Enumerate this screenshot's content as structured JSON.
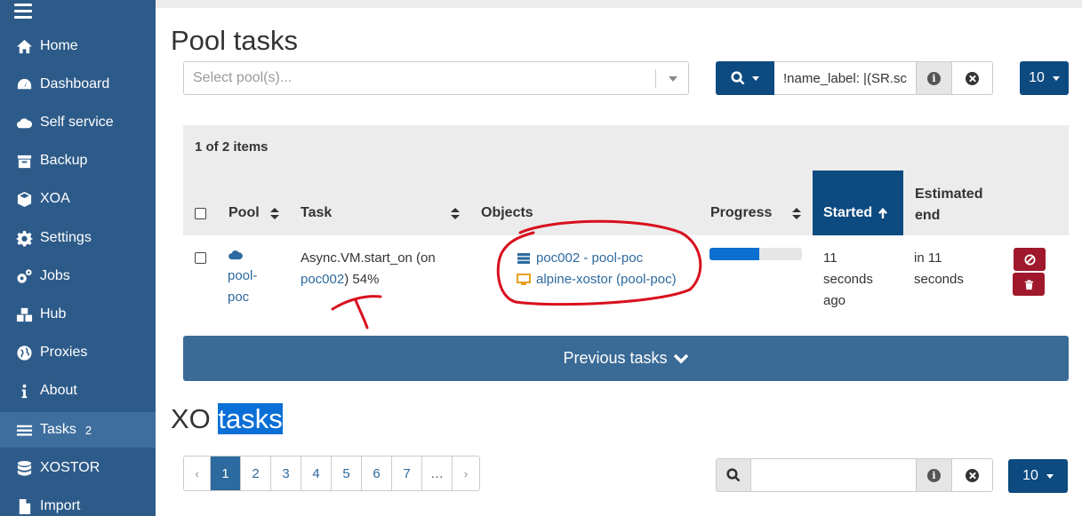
{
  "sidebar": {
    "items": [
      {
        "label": "Home",
        "icon": "home-icon"
      },
      {
        "label": "Dashboard",
        "icon": "dashboard-icon"
      },
      {
        "label": "Self service",
        "icon": "cloud-icon"
      },
      {
        "label": "Backup",
        "icon": "archive-icon"
      },
      {
        "label": "XOA",
        "icon": "cube-icon"
      },
      {
        "label": "Settings",
        "icon": "gear-icon"
      },
      {
        "label": "Jobs",
        "icon": "gears-icon"
      },
      {
        "label": "Hub",
        "icon": "cubes-icon"
      },
      {
        "label": "Proxies",
        "icon": "globe-icon"
      },
      {
        "label": "About",
        "icon": "info-icon"
      },
      {
        "label": "Tasks",
        "icon": "tasks-icon",
        "badge": "2",
        "active": true
      },
      {
        "label": "XOSTOR",
        "icon": "database-icon"
      },
      {
        "label": "Import",
        "icon": "file-import-icon"
      }
    ]
  },
  "pool_tasks": {
    "title": "Pool tasks",
    "pool_select_placeholder": "Select pool(s)...",
    "filter_value": "!name_label: |(SR.sc",
    "page_size": "10",
    "items_count": "1 of 2 items",
    "columns": {
      "pool": "Pool",
      "task": "Task",
      "objects": "Objects",
      "progress": "Progress",
      "started": "Started",
      "estimated_end_1": "Estimated",
      "estimated_end_2": "end"
    },
    "row": {
      "pool_1": "pool-",
      "pool_2": "poc",
      "task_1": "Async.VM.start_on (on",
      "task_host": "poc002",
      "task_pct": ") 54%",
      "object_1": "poc002 - pool-poc",
      "object_2": "alpine-xostor (pool-poc)",
      "progress": 0.54,
      "started_1": "11",
      "started_2": "seconds",
      "started_3": "ago",
      "end_1": "in 11",
      "end_2": "seconds"
    },
    "previous_tasks": "Previous tasks"
  },
  "xo_tasks": {
    "title_1": "XO",
    "title_2": "tasks",
    "pagination": [
      "‹",
      "1",
      "2",
      "3",
      "4",
      "5",
      "6",
      "7",
      "…",
      "›"
    ],
    "active_page": "1",
    "filter_value": "",
    "page_size": "10"
  },
  "colors": {
    "sidebar": "#2d5b89",
    "primary": "#0d4a80",
    "danger": "#a0182b",
    "progress": "#0d6fd0",
    "annotation": "#d8101e"
  }
}
